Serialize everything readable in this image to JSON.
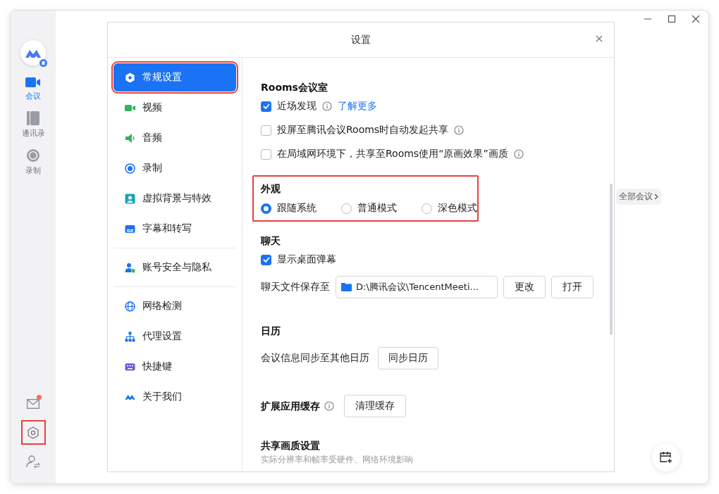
{
  "rail": {
    "items": [
      {
        "label": "会议",
        "selected": true
      },
      {
        "label": "通讯录",
        "selected": false
      },
      {
        "label": "录制",
        "selected": false
      }
    ],
    "bottom": [
      {
        "badge": true,
        "highlighted": false
      },
      {
        "badge": false,
        "highlighted": true
      },
      {
        "badge": false,
        "highlighted": false
      }
    ]
  },
  "background": {
    "all_meetings": "全部会议"
  },
  "dialog": {
    "title": "设置",
    "nav": [
      [
        {
          "label": "常规设置",
          "selected": true,
          "highlighted": true
        },
        {
          "label": "视频",
          "selected": false,
          "highlighted": false
        },
        {
          "label": "音频",
          "selected": false,
          "highlighted": false
        },
        {
          "label": "录制",
          "selected": false,
          "highlighted": false
        },
        {
          "label": "虚拟背景与特效",
          "selected": false,
          "highlighted": false
        },
        {
          "label": "字幕和转写",
          "selected": false,
          "highlighted": false
        }
      ],
      [
        {
          "label": "账号安全与隐私",
          "selected": false,
          "highlighted": false
        }
      ],
      [
        {
          "label": "网络检测",
          "selected": false,
          "highlighted": false
        },
        {
          "label": "代理设置",
          "selected": false,
          "highlighted": false
        },
        {
          "label": "快捷键",
          "selected": false,
          "highlighted": false
        },
        {
          "label": "关于我们",
          "selected": false,
          "highlighted": false
        }
      ]
    ],
    "sections": [
      {
        "title": "Rooms会议室",
        "highlighted": false,
        "rows": [
          {
            "kind": "checkbox",
            "label": "近场发现",
            "checked": true,
            "info": true,
            "link": "了解更多"
          },
          {
            "kind": "checkbox",
            "label": "投屏至腾讯会议Rooms时自动发起共享",
            "checked": false,
            "info": true
          },
          {
            "kind": "checkbox",
            "label": "在局域网环境下，共享至Rooms使用“原画效果”画质",
            "checked": false,
            "info": true
          }
        ]
      },
      {
        "title": "外观",
        "highlighted": true,
        "rows": [
          {
            "kind": "radios",
            "options": [
              {
                "label": "跟随系统",
                "selected": true
              },
              {
                "label": "普通模式",
                "selected": false
              },
              {
                "label": "深色模式",
                "selected": false
              }
            ]
          }
        ]
      },
      {
        "title": "聊天",
        "highlighted": false,
        "rows": [
          {
            "kind": "checkbox",
            "label": "显示桌面弹幕",
            "checked": true,
            "info": false
          },
          {
            "kind": "path",
            "label": "聊天文件保存至",
            "value": "D:\\腾讯会议\\TencentMeeti...",
            "buttons": [
              "更改",
              "打开"
            ]
          }
        ]
      },
      {
        "title": "日历",
        "highlighted": false,
        "rows": [
          {
            "kind": "buttons",
            "label": "会议信息同步至其他日历",
            "buttons": [
              "同步日历"
            ]
          }
        ]
      },
      {
        "title": "扩展应用缓存",
        "highlighted": false,
        "info": true,
        "buttons": [
          "清理缓存"
        ]
      },
      {
        "title": "共享画质设置",
        "highlighted": false,
        "note": "实际分辨率和帧率受硬件、网络环境影响"
      }
    ]
  }
}
